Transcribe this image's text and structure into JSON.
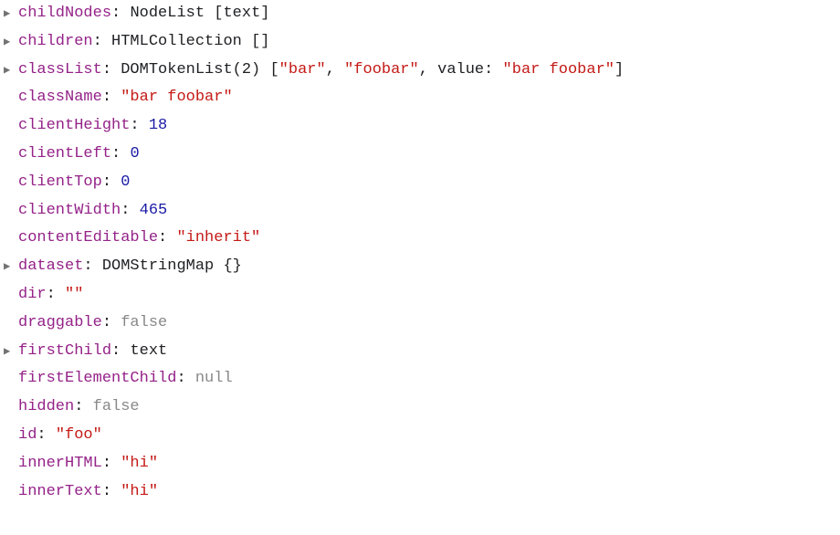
{
  "rows": [
    {
      "arrow": true,
      "key": "childNodes",
      "parts": [
        {
          "t": "typeword",
          "v": "NodeList "
        },
        {
          "t": "punct",
          "v": "["
        },
        {
          "t": "typeword",
          "v": "text"
        },
        {
          "t": "punct",
          "v": "]"
        }
      ]
    },
    {
      "arrow": true,
      "key": "children",
      "parts": [
        {
          "t": "typeword",
          "v": "HTMLCollection "
        },
        {
          "t": "punct",
          "v": "[]"
        }
      ]
    },
    {
      "arrow": true,
      "key": "classList",
      "parts": [
        {
          "t": "typeword",
          "v": "DOMTokenList(2) "
        },
        {
          "t": "punct",
          "v": "["
        },
        {
          "t": "str",
          "v": "\"bar\""
        },
        {
          "t": "punct",
          "v": ", "
        },
        {
          "t": "str",
          "v": "\"foobar\""
        },
        {
          "t": "punct",
          "v": ", value: "
        },
        {
          "t": "str",
          "v": "\"bar foobar\""
        },
        {
          "t": "punct",
          "v": "]"
        }
      ]
    },
    {
      "arrow": false,
      "key": "className",
      "parts": [
        {
          "t": "str",
          "v": "\"bar foobar\""
        }
      ]
    },
    {
      "arrow": false,
      "key": "clientHeight",
      "parts": [
        {
          "t": "num",
          "v": "18"
        }
      ]
    },
    {
      "arrow": false,
      "key": "clientLeft",
      "parts": [
        {
          "t": "num",
          "v": "0"
        }
      ]
    },
    {
      "arrow": false,
      "key": "clientTop",
      "parts": [
        {
          "t": "num",
          "v": "0"
        }
      ]
    },
    {
      "arrow": false,
      "key": "clientWidth",
      "parts": [
        {
          "t": "num",
          "v": "465"
        }
      ]
    },
    {
      "arrow": false,
      "key": "contentEditable",
      "parts": [
        {
          "t": "str",
          "v": "\"inherit\""
        }
      ]
    },
    {
      "arrow": true,
      "key": "dataset",
      "parts": [
        {
          "t": "typeword",
          "v": "DOMStringMap "
        },
        {
          "t": "punct",
          "v": "{}"
        }
      ]
    },
    {
      "arrow": false,
      "key": "dir",
      "parts": [
        {
          "t": "str",
          "v": "\"\""
        }
      ]
    },
    {
      "arrow": false,
      "key": "draggable",
      "parts": [
        {
          "t": "kw",
          "v": "false"
        }
      ]
    },
    {
      "arrow": true,
      "key": "firstChild",
      "parts": [
        {
          "t": "typeword",
          "v": "text"
        }
      ]
    },
    {
      "arrow": false,
      "key": "firstElementChild",
      "parts": [
        {
          "t": "null",
          "v": "null"
        }
      ]
    },
    {
      "arrow": false,
      "key": "hidden",
      "parts": [
        {
          "t": "kw",
          "v": "false"
        }
      ]
    },
    {
      "arrow": false,
      "key": "id",
      "parts": [
        {
          "t": "str",
          "v": "\"foo\""
        }
      ]
    },
    {
      "arrow": false,
      "key": "innerHTML",
      "parts": [
        {
          "t": "str",
          "v": "\"hi\""
        }
      ]
    },
    {
      "arrow": false,
      "key": "innerText",
      "parts": [
        {
          "t": "str",
          "v": "\"hi\""
        }
      ]
    }
  ],
  "glyphs": {
    "arrow": "▶"
  }
}
